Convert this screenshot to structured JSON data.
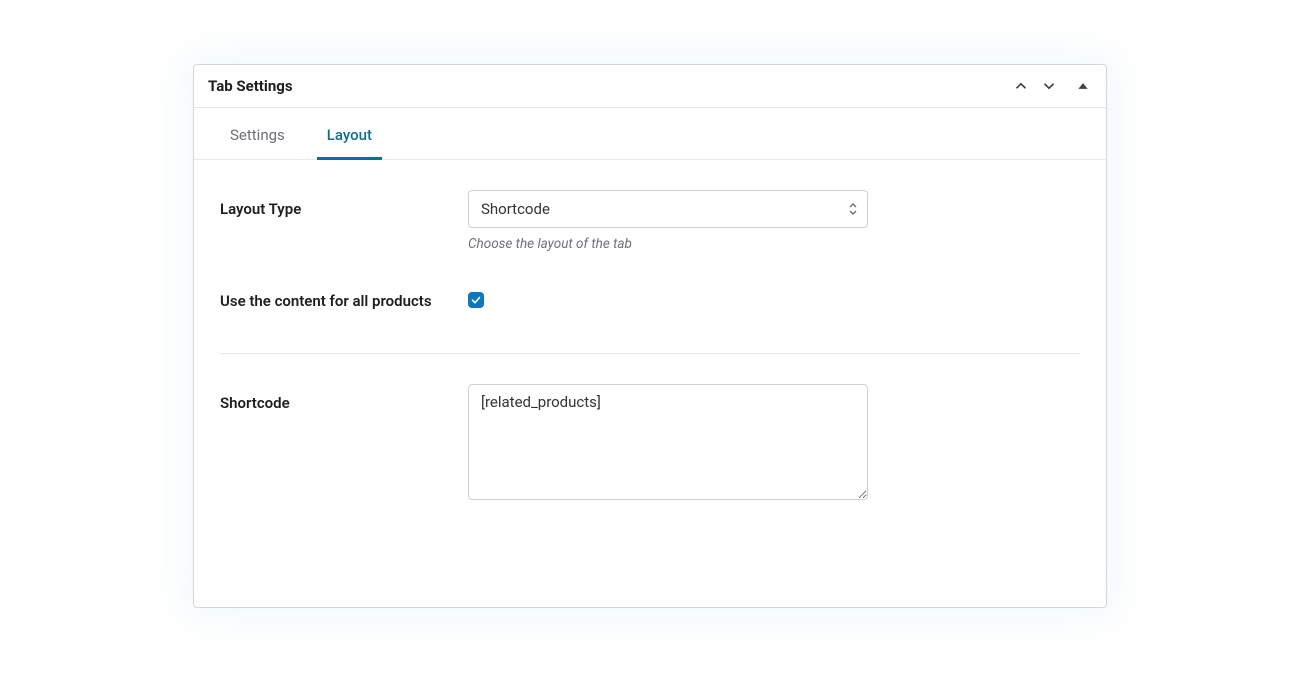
{
  "panel": {
    "title": "Tab Settings"
  },
  "tabs": {
    "settings": "Settings",
    "layout": "Layout"
  },
  "fields": {
    "layout_type": {
      "label": "Layout Type",
      "value": "Shortcode",
      "helper": "Choose the layout of the tab"
    },
    "use_all": {
      "label": "Use the content for all products",
      "checked": true
    },
    "shortcode": {
      "label": "Shortcode",
      "value": "[related_products]"
    }
  }
}
